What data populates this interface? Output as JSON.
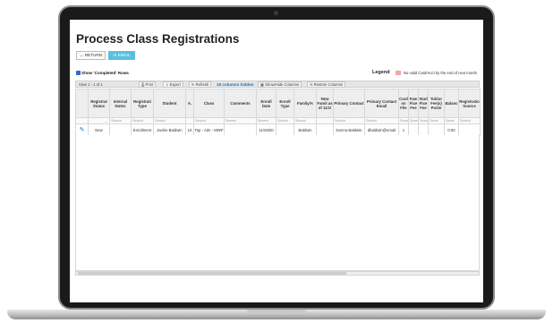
{
  "page": {
    "title": "Process Class Registrations",
    "return_label": "← RETURN",
    "email_label": "✉ EMAIL",
    "show_completed": "Show 'Completed' Rows"
  },
  "legend": {
    "title": "Legend",
    "item": "No valid Card/Acct by the end of next month",
    "color": "#f2a6a6"
  },
  "toolbar": {
    "view_info": "View 1 - 1 of 1",
    "print": "⎙ Print",
    "export": "⇩ Export",
    "refresh": "⟳ Refresh",
    "hidden_count": "19 columns hidden",
    "show_hide": "▦ Show/Hide Columns",
    "restore": "⟲ Restore Columns"
  },
  "columns": [
    "",
    "Registrat Status",
    "Internal Notes",
    "Registrati Type",
    "Student",
    "A.",
    "Class",
    "Comments",
    "Enroll Date",
    "Enroll Type",
    "Family/A",
    "New Famil as of 11/1/",
    "Primary Contact",
    "Primary Contact Email",
    "Card on File",
    "Fam Fixe Fee",
    "Stud Fixe Fee",
    "Tuitior Fee(s) Poste",
    "Balanc",
    "Registratio Source"
  ],
  "filter_placeholder": "Search",
  "filter_placeholder_short": "Searc",
  "row": {
    "edit_icon": "pencil-icon",
    "status": "New",
    "notes": "",
    "type": "Enrollment",
    "student": "Jackie Baldwin",
    "age": "10",
    "class": "Tap - Adv - MWF",
    "comments": "",
    "enroll_date": "11/29/20",
    "enroll_type": "",
    "family": "Baldwin",
    "new_family": "",
    "primary_contact": "Donna Baldwin",
    "primary_email": "dbaldwin@email",
    "card_on_file": "1",
    "fam_fee": "",
    "stud_fee": "",
    "tuition_fee": "",
    "balance": "0.00",
    "source": ""
  },
  "colors": {
    "accent": "#5bc0e0",
    "link": "#1f6fb8",
    "checkbox": "#2a6cc4"
  }
}
